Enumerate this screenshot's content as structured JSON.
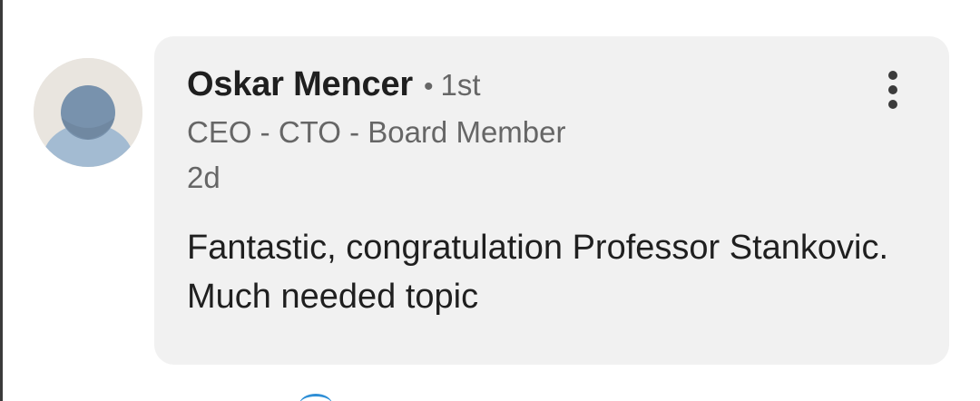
{
  "comment": {
    "author_name": "Oskar Mencer",
    "degree_separator": "•",
    "degree": "1st",
    "headline": "CEO - CTO - Board Member",
    "timestamp": "2d",
    "text": "Fantastic, congratulation Professor Stankovic. Much needed topic",
    "avatar_icon": "default-person-icon",
    "menu_icon": "more-vertical-icon"
  },
  "colors": {
    "bubble_background": "#f1f1f1",
    "primary_text": "#1f1f1f",
    "secondary_text": "#666666",
    "avatar_background": "#e9e5df",
    "avatar_head": "#7892ad",
    "avatar_body": "#a3bbd2",
    "accent": "#2f8fd6"
  }
}
